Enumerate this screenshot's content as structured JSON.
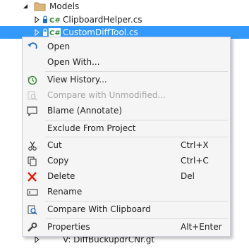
{
  "tree": {
    "models": {
      "label": "Models"
    },
    "helper": {
      "label": "ClipboardHelper.cs",
      "badge": "C#"
    },
    "custom": {
      "label": "CustomDiffTool.cs",
      "badge": "C#"
    },
    "hidden": {
      "label": "V: DiffBuckupdrCNr.gt"
    }
  },
  "menu": {
    "items": [
      {
        "label": "Open",
        "icon": "open-icon"
      },
      {
        "label": "Open With...",
        "icon": ""
      },
      {
        "label": "View History...",
        "icon": "history-icon"
      },
      {
        "label": "Compare with Unmodified...",
        "icon": "compare-unmodified-icon",
        "disabled": true
      },
      {
        "label": "Blame (Annotate)",
        "icon": "blame-icon"
      },
      {
        "label": "Exclude From Project",
        "icon": ""
      },
      {
        "label": "Cut",
        "icon": "scissors-icon",
        "shortcut": "Ctrl+X"
      },
      {
        "label": "Copy",
        "icon": "copy-icon",
        "shortcut": "Ctrl+C"
      },
      {
        "label": "Delete",
        "icon": "delete-icon",
        "shortcut": "Del"
      },
      {
        "label": "Rename",
        "icon": "rename-icon"
      },
      {
        "label": "Compare With Clipboard",
        "icon": "compare-clipboard-icon"
      },
      {
        "label": "Properties",
        "icon": "wrench-icon",
        "shortcut": "Alt+Enter"
      }
    ]
  },
  "colors": {
    "selection": "#3399ff",
    "menu_background": "#f5f5f5",
    "disabled_text": "#a2a4a5",
    "csharp_green": "#388a34",
    "delete_red": "#e51400",
    "icon_blue": "#1e6fc7"
  }
}
